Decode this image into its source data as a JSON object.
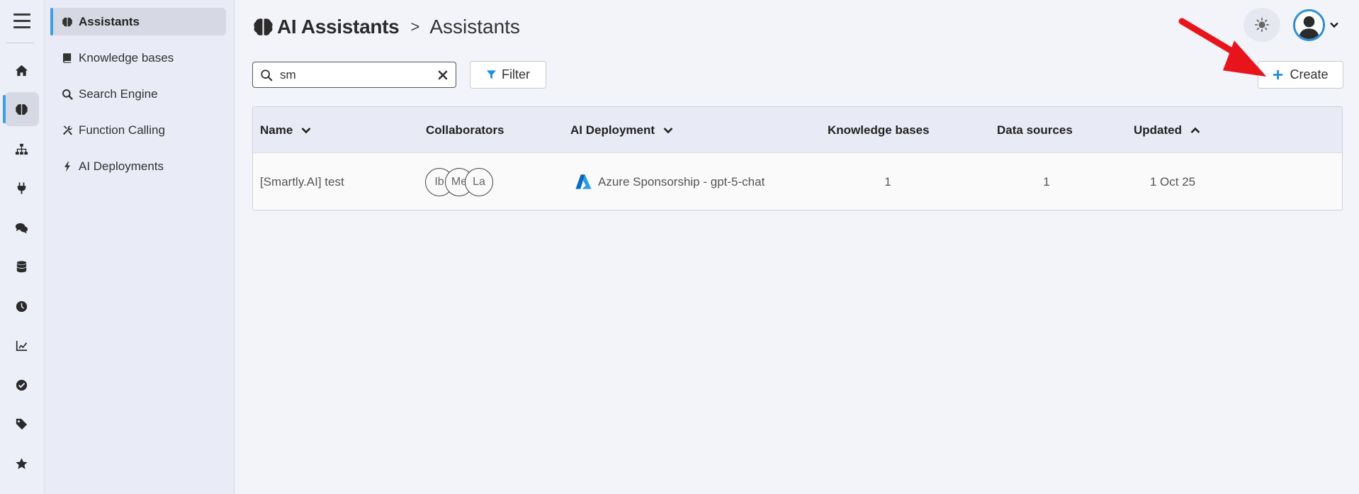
{
  "rail": {
    "items": [
      {
        "icon": "home-icon"
      },
      {
        "icon": "brain-icon",
        "active": true
      },
      {
        "icon": "sitemap-icon"
      },
      {
        "icon": "plug-icon"
      },
      {
        "icon": "comments-icon"
      },
      {
        "icon": "database-icon"
      },
      {
        "icon": "clock-icon"
      },
      {
        "icon": "chart-line-icon"
      },
      {
        "icon": "check-circle-icon"
      },
      {
        "icon": "tag-icon"
      },
      {
        "icon": "star-icon"
      }
    ]
  },
  "subnav": {
    "items": [
      {
        "label": "Assistants",
        "icon": "brain-icon",
        "active": true
      },
      {
        "label": "Knowledge bases",
        "icon": "book-icon"
      },
      {
        "label": "Search Engine",
        "icon": "search-icon"
      },
      {
        "label": "Function Calling",
        "icon": "tools-icon"
      },
      {
        "label": "AI Deployments",
        "icon": "bolt-icon"
      }
    ]
  },
  "header": {
    "section": "AI Assistants",
    "separator": ">",
    "page": "Assistants"
  },
  "toolbar": {
    "search_value": "sm",
    "filter_label": "Filter",
    "create_label": "Create"
  },
  "table": {
    "columns": {
      "name": "Name",
      "collaborators": "Collaborators",
      "deployment": "AI Deployment",
      "knowledge_bases": "Knowledge bases",
      "data_sources": "Data sources",
      "updated": "Updated"
    },
    "rows": [
      {
        "name": "[Smartly.AI] test",
        "collaborators": [
          "Ib",
          "Me",
          "La"
        ],
        "deployment": "Azure Sponsorship - gpt-5-chat",
        "knowledge_bases": "1",
        "data_sources": "1",
        "updated": "1 Oct 25"
      }
    ]
  },
  "colors": {
    "accent": "#3d9ee8",
    "annotation_arrow": "#e8141b"
  }
}
